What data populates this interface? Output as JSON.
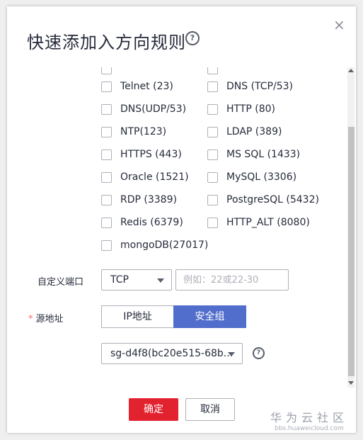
{
  "dialog": {
    "title": "快速添加入方向规则",
    "help_icon": "question-circle-icon",
    "close_icon": "close-icon",
    "close_glyph": "×"
  },
  "protocols": [
    {
      "label": "Telnet (23)"
    },
    {
      "label": "DNS (TCP/53)"
    },
    {
      "label": "DNS(UDP/53)"
    },
    {
      "label": "HTTP (80)"
    },
    {
      "label": "NTP(123)"
    },
    {
      "label": "LDAP (389)"
    },
    {
      "label": "HTTPS (443)"
    },
    {
      "label": "MS SQL (1433)"
    },
    {
      "label": "Oracle (1521)"
    },
    {
      "label": "MySQL (3306)"
    },
    {
      "label": "RDP (3389)"
    },
    {
      "label": "PostgreSQL (5432)"
    },
    {
      "label": "Redis (6379)"
    },
    {
      "label": "HTTP_ALT (8080)"
    },
    {
      "label": "mongoDB(27017)"
    }
  ],
  "custom_port": {
    "label": "自定义端口",
    "protocol_value": "TCP",
    "port_placeholder": "例如：22或22-30"
  },
  "source": {
    "required_mark": "*",
    "label": "源地址",
    "tab_ip": "IP地址",
    "tab_sg": "安全组",
    "selected_tab": "安全组",
    "sg_value": "sg-d4f8(bc20e515-68b..."
  },
  "footer": {
    "ok_label": "确定",
    "cancel_label": "取消"
  },
  "watermark": {
    "text": "华为云社区",
    "url": "bbs.huaweicloud.com"
  },
  "colors": {
    "primary_button": "#e3222f",
    "selected_tab": "#526ecc"
  }
}
